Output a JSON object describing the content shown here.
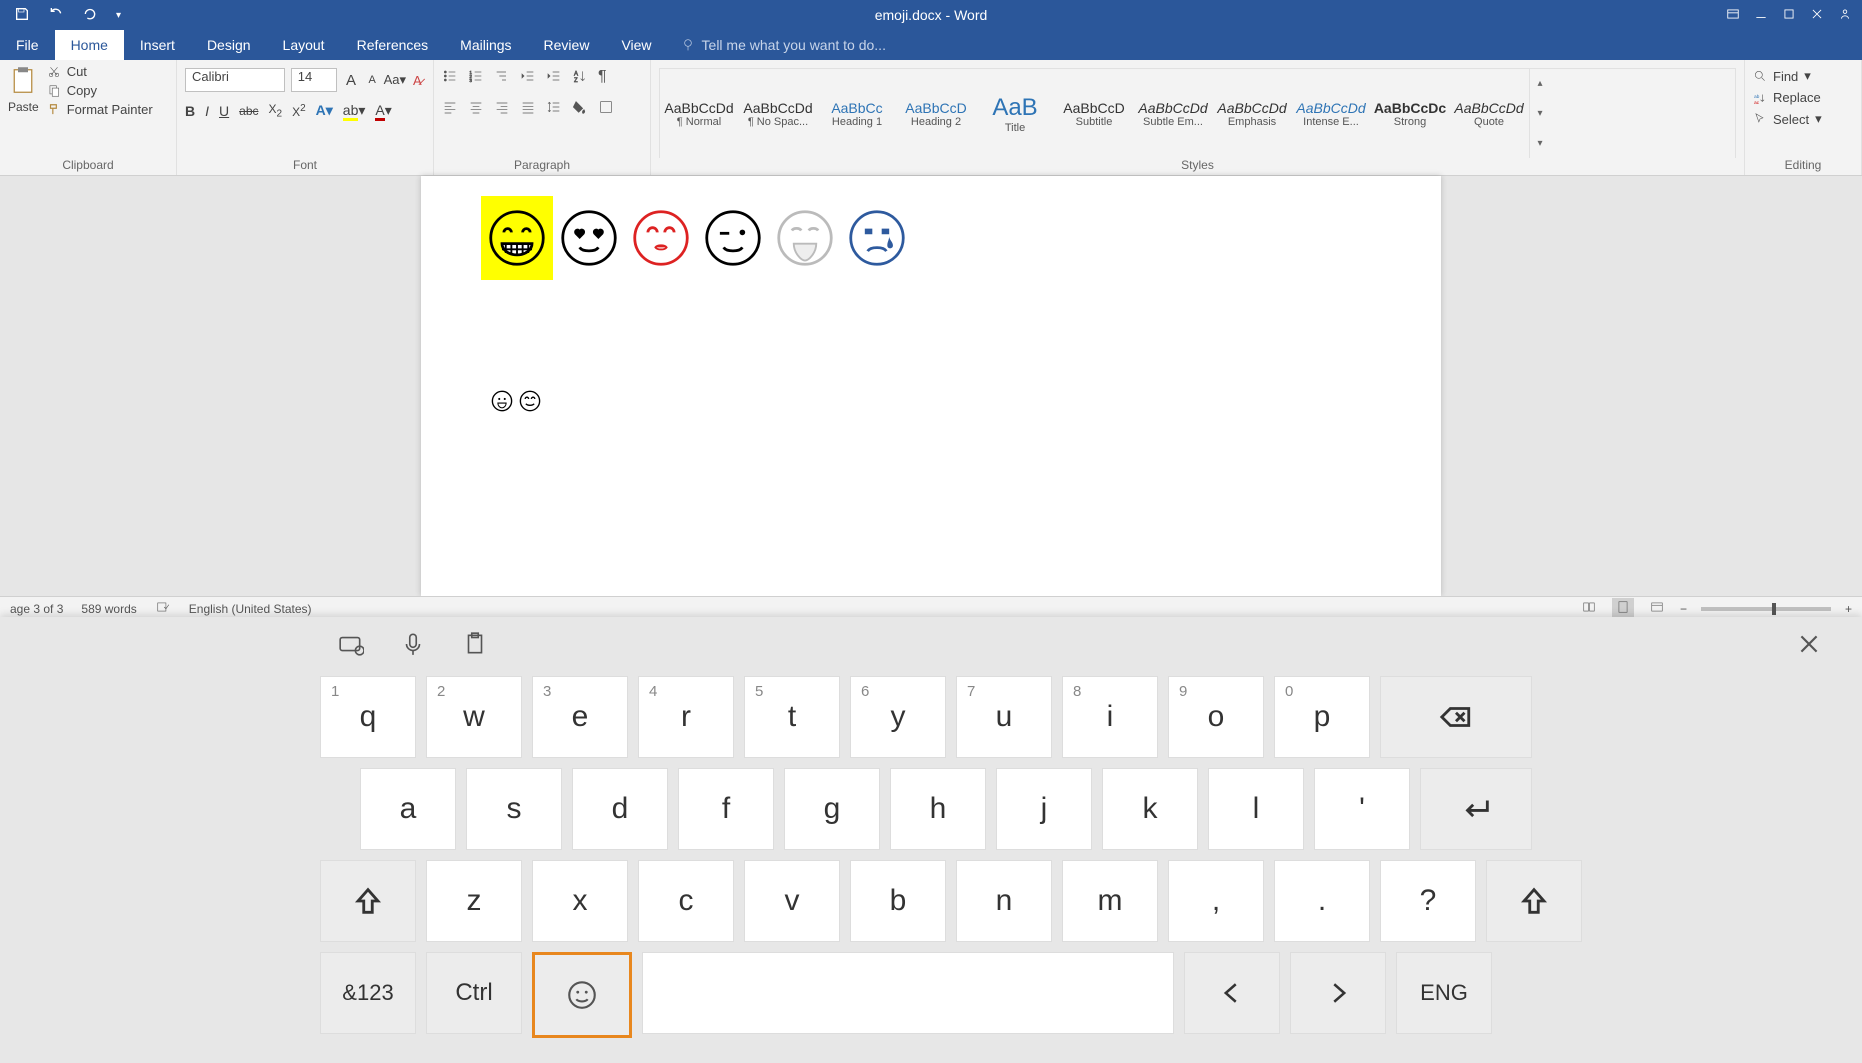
{
  "titlebar": {
    "title": "emoji.docx - Word"
  },
  "tabs": {
    "file": "File",
    "items": [
      "Home",
      "Insert",
      "Design",
      "Layout",
      "References",
      "Mailings",
      "Review",
      "View"
    ],
    "active": "Home",
    "tellme_placeholder": "Tell me what you want to do..."
  },
  "clipboard": {
    "paste": "Paste",
    "cut": "Cut",
    "copy": "Copy",
    "format_painter": "Format Painter",
    "group_label": "Clipboard"
  },
  "font": {
    "name": "Calibri",
    "size": "14",
    "group_label": "Font"
  },
  "paragraph": {
    "group_label": "Paragraph"
  },
  "styles": {
    "group_label": "Styles",
    "items": [
      {
        "preview": "AaBbCcDd",
        "label": "¶ Normal",
        "cls": ""
      },
      {
        "preview": "AaBbCcDd",
        "label": "¶ No Spac...",
        "cls": ""
      },
      {
        "preview": "AaBbCc",
        "label": "Heading 1",
        "cls": "blue"
      },
      {
        "preview": "AaBbCcD",
        "label": "Heading 2",
        "cls": "blue"
      },
      {
        "preview": "AaB",
        "label": "Title",
        "cls": "big"
      },
      {
        "preview": "AaBbCcD",
        "label": "Subtitle",
        "cls": ""
      },
      {
        "preview": "AaBbCcDd",
        "label": "Subtle Em...",
        "cls": "ital"
      },
      {
        "preview": "AaBbCcDd",
        "label": "Emphasis",
        "cls": "ital"
      },
      {
        "preview": "AaBbCcDd",
        "label": "Intense E...",
        "cls": "ital blue"
      },
      {
        "preview": "AaBbCcDc",
        "label": "Strong",
        "cls": "bold"
      },
      {
        "preview": "AaBbCcDd",
        "label": "Quote",
        "cls": "ital"
      }
    ]
  },
  "editing": {
    "find": "Find",
    "replace": "Replace",
    "select": "Select",
    "group_label": "Editing"
  },
  "statusbar": {
    "page": "age 3 of 3",
    "words": "589 words",
    "lang": "English (United States)"
  },
  "osk": {
    "row1": [
      {
        "k": "q",
        "s": "1"
      },
      {
        "k": "w",
        "s": "2"
      },
      {
        "k": "e",
        "s": "3"
      },
      {
        "k": "r",
        "s": "4"
      },
      {
        "k": "t",
        "s": "5"
      },
      {
        "k": "y",
        "s": "6"
      },
      {
        "k": "u",
        "s": "7"
      },
      {
        "k": "i",
        "s": "8"
      },
      {
        "k": "o",
        "s": "9"
      },
      {
        "k": "p",
        "s": "0"
      }
    ],
    "row2": [
      "a",
      "s",
      "d",
      "f",
      "g",
      "h",
      "j",
      "k",
      "l",
      "'"
    ],
    "row3": [
      "z",
      "x",
      "c",
      "v",
      "b",
      "n",
      "m",
      ",",
      ".",
      "?"
    ],
    "numkey": "&123",
    "ctrl": "Ctrl",
    "lang": "ENG"
  }
}
